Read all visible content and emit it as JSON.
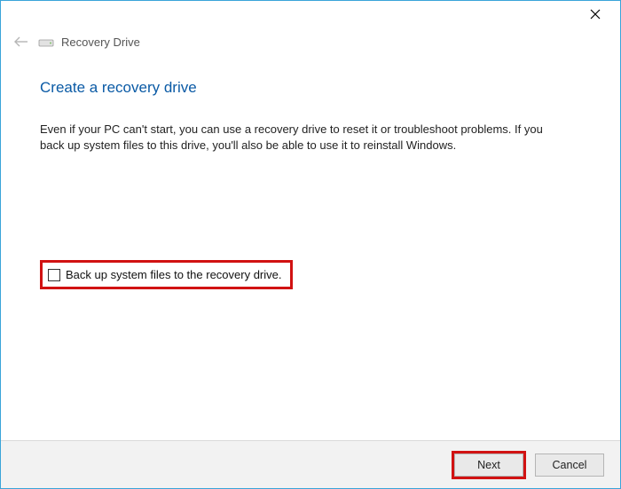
{
  "window": {
    "title": "Recovery Drive"
  },
  "main": {
    "heading": "Create a recovery drive",
    "description": "Even if your PC can't start, you can use a recovery drive to reset it or troubleshoot problems. If you back up system files to this drive, you'll also be able to use it to reinstall Windows."
  },
  "option": {
    "backup_label": "Back up system files to the recovery drive.",
    "backup_checked": false
  },
  "footer": {
    "next_label": "Next",
    "cancel_label": "Cancel"
  },
  "highlights": {
    "color": "#d11212"
  }
}
